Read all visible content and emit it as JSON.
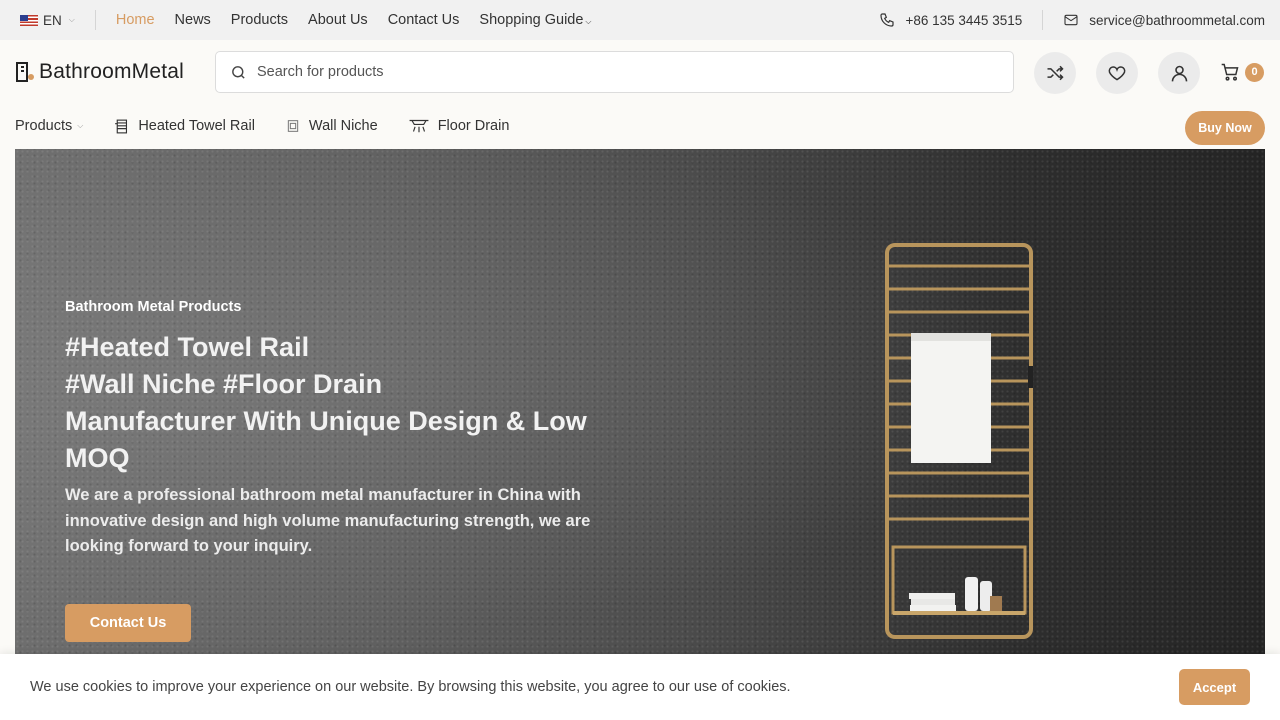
{
  "topbar": {
    "language": "EN",
    "nav": [
      "Home",
      "News",
      "Products",
      "About Us",
      "Contact Us",
      "Shopping Guide"
    ],
    "phone": "+86 135 3445 3515",
    "email": "service@bathroommetal.com"
  },
  "header": {
    "logo_text": "BathroomMetal",
    "search_placeholder": "Search for products",
    "cart_count": "0"
  },
  "navrow": {
    "products_label": "Products",
    "items": [
      "Heated Towel Rail",
      "Wall Niche",
      "Floor Drain"
    ],
    "buy_now": "Buy Now"
  },
  "hero": {
    "subtitle": "Bathroom Metal Products",
    "title_lines": [
      "#Heated Towel Rail",
      "#Wall Niche #Floor Drain",
      "Manufacturer With Unique Design & Low",
      "MOQ"
    ],
    "description": "We are a professional bathroom metal manufacturer in China with innovative design and high volume manufacturing strength, we are looking forward to your inquiry.",
    "button": "Contact Us"
  },
  "cookie": {
    "text": "We use cookies to improve your experience on our website. By browsing this website, you agree to our use of cookies.",
    "accept": "Accept"
  },
  "colors": {
    "accent": "#d79c62",
    "topbar_bg": "#f1f1f1"
  },
  "icons": [
    "flag-us-icon",
    "phone-icon",
    "mail-icon",
    "search-icon",
    "shuffle-icon",
    "heart-icon",
    "user-icon",
    "cart-icon",
    "towel-rail-icon",
    "wall-niche-icon",
    "floor-drain-icon"
  ]
}
